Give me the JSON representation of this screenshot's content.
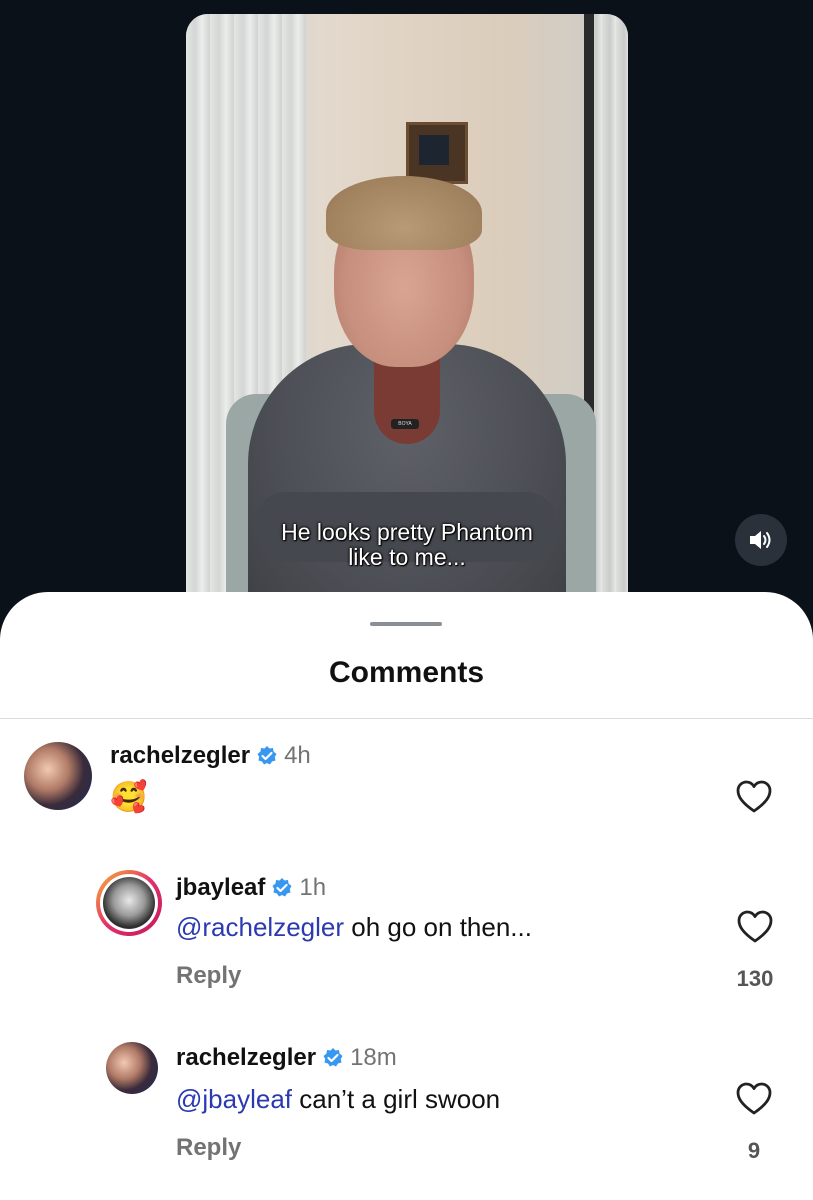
{
  "video": {
    "caption": "He looks pretty Phantom\nlike to me...",
    "mic_brand": "BOYA"
  },
  "sheet": {
    "title": "Comments"
  },
  "comments": [
    {
      "username": "rachelzegler",
      "verified": true,
      "time": "4h",
      "text": "🥰",
      "likes": ""
    },
    {
      "username": "jbayleaf",
      "verified": true,
      "time": "1h",
      "mention": "@rachelzegler",
      "text": "oh go on then...",
      "reply_label": "Reply",
      "likes": "130"
    },
    {
      "username": "rachelzegler",
      "verified": true,
      "time": "18m",
      "mention": "@jbayleaf",
      "text": "can’t a girl swoon",
      "reply_label": "Reply",
      "likes": "9"
    }
  ],
  "colors": {
    "background": "#0b1119",
    "verified_badge": "#3897f0",
    "mention": "#2b3ab0",
    "story_ring_start": "#f7b733",
    "story_ring_end": "#c2185b"
  }
}
